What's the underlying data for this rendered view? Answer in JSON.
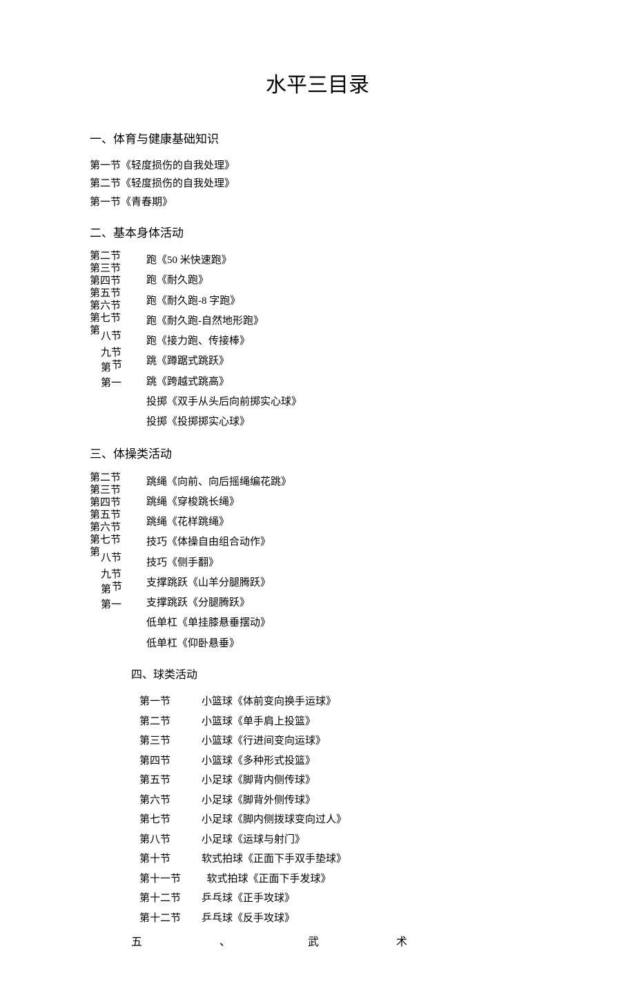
{
  "title": "水平三目录",
  "s1": {
    "heading": "一、体育与健康基础知识",
    "items": [
      "第一节《轻度损伤的自我处理》",
      "第二节《轻度损伤的自我处理》",
      "第一节《青春期》"
    ]
  },
  "s2": {
    "heading": "二、基本身体活动",
    "left": {
      "a": "第二节",
      "b": "第三节",
      "c": "第四节",
      "d": "第五节",
      "e": "第六节",
      "f": "第七节",
      "g": "第",
      "h": "八节",
      "i": "九节",
      "j": "第",
      "k": "节",
      "l": "第一"
    },
    "right": [
      "跑《50 米快速跑》",
      "跑《耐久跑》",
      "跑《耐久跑-8 字跑》",
      "跑《耐久跑-自然地形跑》",
      "跑《接力跑、传接棒》",
      "跳《蹲踞式跳跃》",
      "跳《跨越式跳高》",
      "投掷《双手从头后向前掷实心球》",
      "投掷《投掷掷实心球》"
    ]
  },
  "s3": {
    "heading": "三、体操类活动",
    "left": {
      "a": "第二节",
      "b": "第三节",
      "c": "第四节",
      "d": "第五节",
      "e": "第六节",
      "f": "第七节",
      "g": "第",
      "h": "八节",
      "i": "九节",
      "j": "第",
      "k": "节",
      "l": "第一"
    },
    "right": [
      "跳绳《向前、向后摇绳编花跳》",
      "跳绳《穿梭跳长绳》",
      "跳绳《花样跳绳》",
      "技巧《体操自由组合动作》",
      "技巧《侧手翻》",
      "支撑跳跃《山羊分腿腾跃》",
      "支撑跳跃《分腿腾跃》",
      "低单杠《单挂膝悬垂摆动》",
      "低单杠《仰卧悬垂》"
    ]
  },
  "s4": {
    "heading": "四、球类活动",
    "rows": [
      {
        "label": "第一节",
        "text": "小篮球《体前变向换手运球》"
      },
      {
        "label": "第二节",
        "text": "小篮球《单手肩上投篮》"
      },
      {
        "label": "第三节",
        "text": "小篮球《行进间变向运球》"
      },
      {
        "label": "第四节",
        "text": "小篮球《多种形式投篮》"
      },
      {
        "label": "第五节",
        "text": "小足球《脚背内侧传球》"
      },
      {
        "label": "第六节",
        "text": "小足球《脚背外侧传球》"
      },
      {
        "label": "第七节",
        "text": "小足球《脚内侧拨球变向过人》"
      },
      {
        "label": "第八节",
        "text": "小足球《运球与射门》"
      },
      {
        "label": "第十节",
        "text": "软式拍球《正面下手双手垫球》"
      },
      {
        "label": "第十一节",
        "text": "  软式拍球《正面下手发球》"
      },
      {
        "label": "第十二节",
        "text": "乒乓球《正手攻球》"
      },
      {
        "label": "第十二节",
        "text": "乒乓球《反手攻球》"
      }
    ]
  },
  "s5": {
    "a": "五",
    "b": "、",
    "c": "武",
    "d": "术"
  }
}
